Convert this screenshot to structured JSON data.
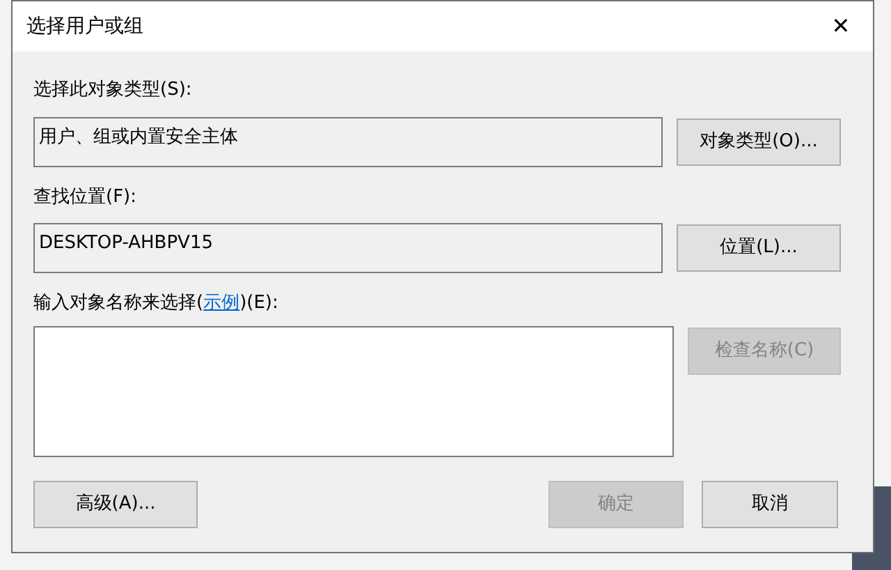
{
  "window": {
    "title": "选择用户或组",
    "close": "✕"
  },
  "object_type": {
    "label": "选择此对象类型(S):",
    "value": "用户、组或内置安全主体",
    "button": {
      "label": "对象类型(O)...",
      "disabled": false
    }
  },
  "location": {
    "label": "查找位置(F):",
    "value": "DESKTOP-AHBPV15",
    "button": {
      "label": "位置(L)...",
      "disabled": false
    }
  },
  "names": {
    "label_before": "输入对象名称来选择(",
    "link": "示例",
    "label_after": ")(E):",
    "button": {
      "label": "检查名称(C)",
      "disabled": true
    }
  },
  "buttons": [
    {
      "label": "高级(A)...",
      "disabled": false
    },
    {
      "label": "确定",
      "disabled": true
    },
    {
      "label": "取消",
      "disabled": false
    }
  ]
}
